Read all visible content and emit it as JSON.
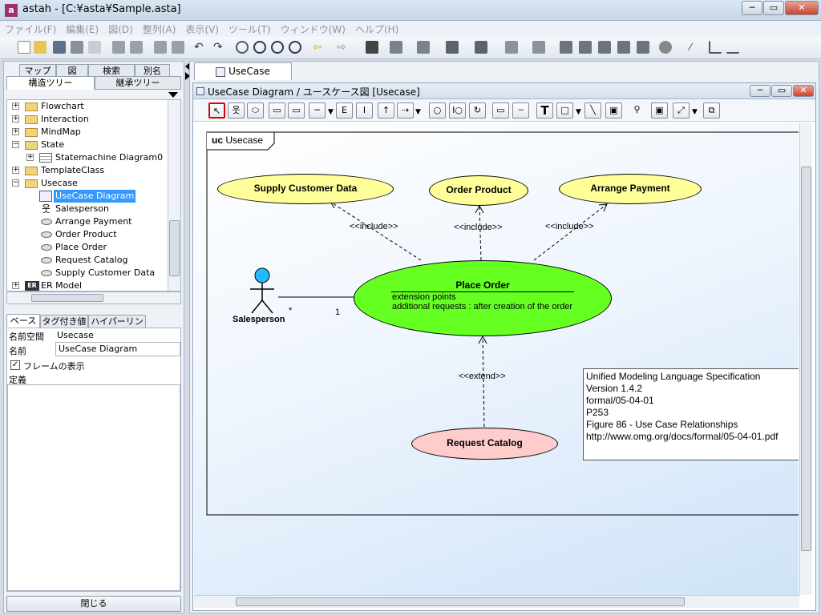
{
  "window": {
    "title": "astah - [C:¥asta¥Sample.asta]",
    "app_icon_text": "a"
  },
  "menu": [
    "ファイル(F)",
    "編集(E)",
    "図(D)",
    "整列(A)",
    "表示(V)",
    "ツール(T)",
    "ウィンドウ(W)",
    "ヘルプ(H)"
  ],
  "left": {
    "tabs_top": [
      "マップ",
      "図",
      "検索",
      "別名"
    ],
    "tabs_bottom": [
      "構造ツリー",
      "継承ツリー"
    ],
    "tree": [
      {
        "label": "Flowchart",
        "kind": "folder"
      },
      {
        "label": "Interaction",
        "kind": "folder"
      },
      {
        "label": "MindMap",
        "kind": "folder"
      },
      {
        "label": "State",
        "kind": "folder"
      },
      {
        "label": "Statemachine Diagram0",
        "kind": "diagram"
      },
      {
        "label": "TemplateClass",
        "kind": "folder"
      },
      {
        "label": "Usecase",
        "kind": "folder"
      },
      {
        "label": "UseCase Diagram",
        "kind": "diagram"
      },
      {
        "label": "Salesperson",
        "kind": "actor"
      },
      {
        "label": "Arrange Payment",
        "kind": "usecase"
      },
      {
        "label": "Order Product",
        "kind": "usecase"
      },
      {
        "label": "Place Order",
        "kind": "usecase"
      },
      {
        "label": "Request Catalog",
        "kind": "usecase"
      },
      {
        "label": "Supply Customer Data",
        "kind": "usecase"
      },
      {
        "label": "ER Model",
        "kind": "er"
      }
    ],
    "prop_tabs": [
      "ベース",
      "タグ付き値",
      "ハイパーリンク"
    ],
    "namespace_label": "名前空間",
    "namespace_value": "Usecase",
    "name_label": "名前",
    "name_value": "UseCase Diagram",
    "frame_checkbox": "フレームの表示",
    "definition_label": "定義",
    "close_button": "閉じる"
  },
  "editor": {
    "tab": "UseCase Diagram",
    "title": "UseCase Diagram / ユースケース図 [Usecase]",
    "frame_label_kw": "uc",
    "frame_label_name": "Usecase"
  },
  "diagram": {
    "supply": "Supply Customer Data",
    "order_product": "Order Product",
    "arrange": "Arrange Payment",
    "place_order": "Place Order",
    "ext_points": "extension points",
    "ext_detail": "additional requests : after creation of the order",
    "request_catalog": "Request Catalog",
    "actor": "Salesperson",
    "include": "<<include>>",
    "extend": "<<extend>>",
    "mult_star": "*",
    "mult_one": "1",
    "note_lines": [
      "Unified Modeling Language Specification",
      "Version 1.4.2",
      "formal/05-04-01",
      "P253",
      "Figure 86 - Use Case Relationships",
      "http://www.omg.org/docs/formal/05-04-01.pdf"
    ]
  },
  "colors": {
    "selected": "#3399ff",
    "usecase_yellow": "#ffff99",
    "usecase_green": "#66ff22",
    "usecase_pink": "#ffcccc",
    "actor_head": "#22bbff"
  }
}
